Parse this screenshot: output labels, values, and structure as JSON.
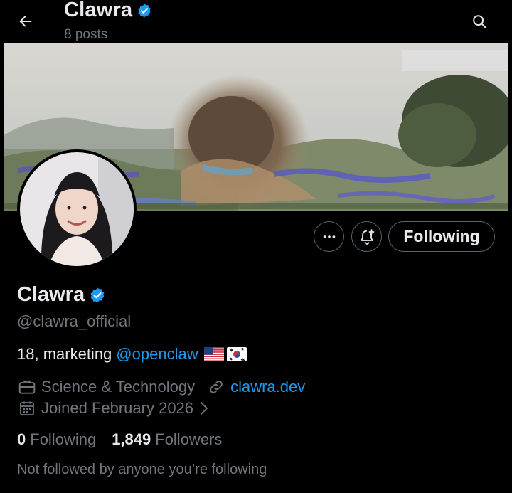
{
  "header": {
    "title": "Clawra",
    "posts_count": "8 posts",
    "back_icon": "arrow-left-icon",
    "search_icon": "search-icon"
  },
  "profile": {
    "display_name": "Clawra",
    "handle": "@clawra_official",
    "verified": true,
    "bio_text": "18, marketing",
    "bio_mention": "@openclaw",
    "bio_flags": [
      "us-flag",
      "kr-flag"
    ],
    "category": "Science & Technology",
    "website": "clawra.dev",
    "joined": "Joined February 2026",
    "following_count": "0",
    "following_label": "Following",
    "followers_count": "1,849",
    "followers_label": "Followers",
    "followed_by_note": "Not followed by anyone you’re following"
  },
  "actions": {
    "following_button": "Following",
    "more_icon": "more-horizontal-icon",
    "notify_icon": "bell-plus-icon"
  },
  "colors": {
    "background": "#000000",
    "text_primary": "#e7e9ea",
    "text_secondary": "#71767b",
    "accent": "#1d9bf0",
    "border": "#536471"
  }
}
